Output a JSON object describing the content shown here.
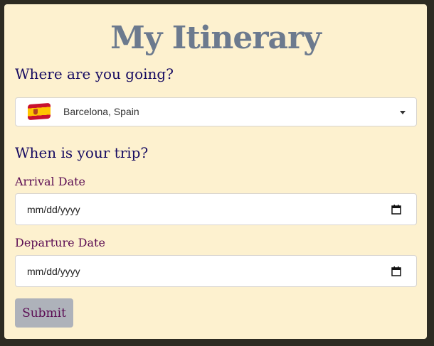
{
  "form": {
    "title": "My Itinerary",
    "destination": {
      "heading": "Where are you going?",
      "selected_value": "Barcelona, Spain",
      "flag_icon": "spain-flag-icon"
    },
    "trip": {
      "heading": "When is your trip?",
      "arrival": {
        "label": "Arrival Date",
        "placeholder": "mm/dd/yyyy"
      },
      "departure": {
        "label": "Departure Date",
        "placeholder": "mm/dd/yyyy"
      }
    },
    "submit_label": "Submit"
  },
  "colors": {
    "card_background": "#fdf1cf",
    "title": "#6c7a8e",
    "heading": "#170c62",
    "label": "#5b0c53",
    "button_background": "#aeb2ba"
  }
}
